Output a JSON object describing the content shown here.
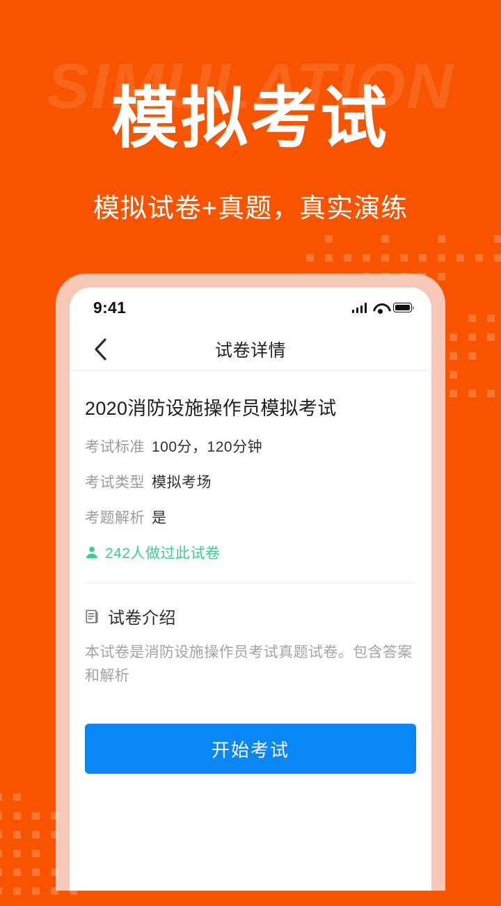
{
  "hero": {
    "watermark": "SIMULATION",
    "title": "模拟考试",
    "subtitle": "模拟试卷+真题，真实演练"
  },
  "phone": {
    "status_bar": {
      "time": "9:41",
      "signal_icon": "signal-bars-icon",
      "wifi_icon": "wifi-icon",
      "battery_icon": "battery-full-icon"
    },
    "nav": {
      "back_icon": "chevron-left-icon",
      "title": "试卷详情"
    },
    "paper": {
      "title": "2020消防设施操作员模拟考试",
      "info": [
        {
          "label": "考试标准",
          "value": "100分，120分钟"
        },
        {
          "label": "考试类型",
          "value": "模拟考场"
        },
        {
          "label": "考题解析",
          "value": "是"
        }
      ],
      "people": {
        "icon": "person-icon",
        "text": "242人做过此试卷"
      },
      "intro": {
        "icon": "document-list-icon",
        "title": "试卷介绍",
        "body": "本试卷是消防设施操作员考试真题试卷。包含答案和解析"
      },
      "cta_label": "开始考试"
    }
  },
  "colors": {
    "background_orange": "#F85400",
    "phone_frame_peach": "#F5C8B7",
    "accent_green": "#3ACE93",
    "cta_blue": "#0B86F5",
    "title_white": "#FFFFFF"
  }
}
